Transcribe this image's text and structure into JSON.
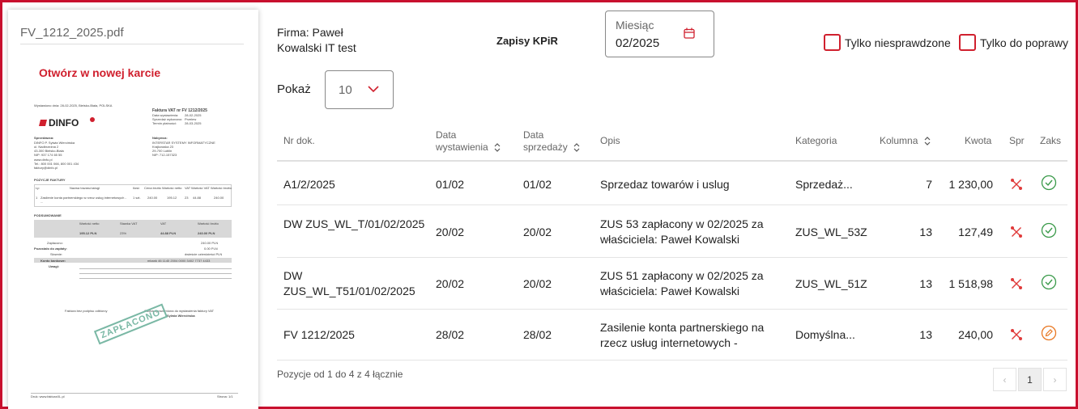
{
  "preview": {
    "filename": "FV_1212_2025.pdf",
    "open_link": "Otwórz w nowej karcie",
    "doc": {
      "issued": "Wystawiono dnia: 28-02-2025, Bielsko-Biała, POLSKA",
      "invoice_title": "Faktura VAT nr FV 1212/2025",
      "date_issue_label": "Data wystawienia:",
      "date_issue": "28-02-2025",
      "date_sale_label": "Sprzedaż wykonano:",
      "date_sale": "Przelew",
      "date_due_label": "Termin płatności:",
      "date_due": "28-03-2025",
      "logo": "DINFO",
      "seller_label": "Sprzedawca:",
      "seller_lines": [
        "DINFO P. Sylwia Wiercińska",
        "ul. Nadbrzeżna 2",
        "43-300 Bielsko-Biała",
        "NIP: 937 174 65 55",
        "www.dinfo.pl",
        "Tel.: 800 001 066, 800 001 434",
        "faktury@dinfo.pl"
      ],
      "buyer_label": "Nabywca:",
      "buyer_lines": [
        "INTERSTAR SYSTEMY INFORMATYCZNE",
        "Krajkowska 23",
        "29-700 Lublin",
        "NIP: 712-157323"
      ],
      "items_header": "POZYCJE FAKTURY",
      "items_cols": [
        "Lp",
        "Nazwa towaru/usługi",
        "Ilość",
        "Cena brutto",
        "Wartość netto",
        "VAT",
        "Wartość VAT",
        "Wartość brutto"
      ],
      "item_row": [
        "1",
        "Zasilenie konta partnerskiego w rzecz usług internetowych - ...",
        "1 szt.",
        "240.00",
        "195.12",
        "23",
        "44.88",
        "240.00"
      ],
      "summary_header": "PODSUMOWANIE",
      "summary_rows": [
        "Wartość netto",
        "Stawka VAT",
        "VAT",
        "Wartość brutto"
      ],
      "summary_vals": [
        "195.12 PLN",
        "23%",
        "44.88 PLN",
        "240.00 PLN"
      ],
      "paid_label": "Zapłacono:",
      "paid": "240.00 PLN",
      "remaining_label": "Pozostało do zapłaty:",
      "remaining": "0.00 PLN",
      "words_label": "Słownie:",
      "words": "dwieście czterdzieści PLN",
      "account_label": "Konto bankowe:",
      "account": "mbank 46 1140 2004 0000 3402 7737 4433",
      "notes_label": "Uwagi:",
      "footer_left": "Faktura bez podpisu odbiorcy",
      "footer_right": "Osoba upoważniona do wystawienia faktury VAT",
      "footer_name": "Sylwia Wiercińska",
      "stamp": "ZAPŁACONO",
      "page_left": "Druk: www.fakturaXL.pl",
      "page_right": "Strona: 1/1"
    }
  },
  "header": {
    "company": "Firma: Paweł Kowalski IT test",
    "title": "Zapisy KPiR",
    "month_label": "Miesiąc",
    "month_value": "02/2025",
    "filter_unchecked": "Tylko niesprawdzone",
    "filter_to_fix": "Tylko do poprawy",
    "show_label": "Pokaż",
    "page_size": "10"
  },
  "table": {
    "columns": {
      "nr": "Nr dok.",
      "date_issue": "Data wystawienia",
      "date_sale": "Data sprzedaży",
      "desc": "Opis",
      "category": "Kategoria",
      "column": "Kolumna",
      "amount": "Kwota",
      "checked": "Spr",
      "status": "Zaks"
    },
    "rows": [
      {
        "nr": "A1/2/2025",
        "date_issue": "01/02",
        "date_sale": "01/02",
        "desc": "Sprzedaz towarów i uslug",
        "category": "Sprzedaż...",
        "column": "7",
        "amount": "1 230,00",
        "status": "ok"
      },
      {
        "nr": "DW ZUS_WL_T/01/02/2025",
        "date_issue": "20/02",
        "date_sale": "20/02",
        "desc": "ZUS 53 zapłacony w 02/2025 za właściciela: Paweł Kowalski",
        "category": "ZUS_WL_53Z",
        "column": "13",
        "amount": "127,49",
        "status": "ok"
      },
      {
        "nr": "DW ZUS_WL_T51/01/02/2025",
        "date_issue": "20/02",
        "date_sale": "20/02",
        "desc": "ZUS 51 zapłacony w 02/2025 za właściciela: Paweł Kowalski",
        "category": "ZUS_WL_51Z",
        "column": "13",
        "amount": "1 518,98",
        "status": "ok"
      },
      {
        "nr": "FV 1212/2025",
        "date_issue": "28/02",
        "date_sale": "28/02",
        "desc": "Zasilenie konta partnerskiego na rzecz usług internetowych -",
        "category": "Domyślna...",
        "column": "13",
        "amount": "240,00",
        "status": "edit"
      }
    ],
    "info": "Pozycje od 1 do 4 z 4 łącznie",
    "pager": {
      "prev": "‹",
      "current": "1",
      "next": "›"
    }
  },
  "colors": {
    "accent": "#d0202e",
    "ok": "#3a9a4a",
    "edit": "#e87722",
    "frame": "#c8102e"
  }
}
